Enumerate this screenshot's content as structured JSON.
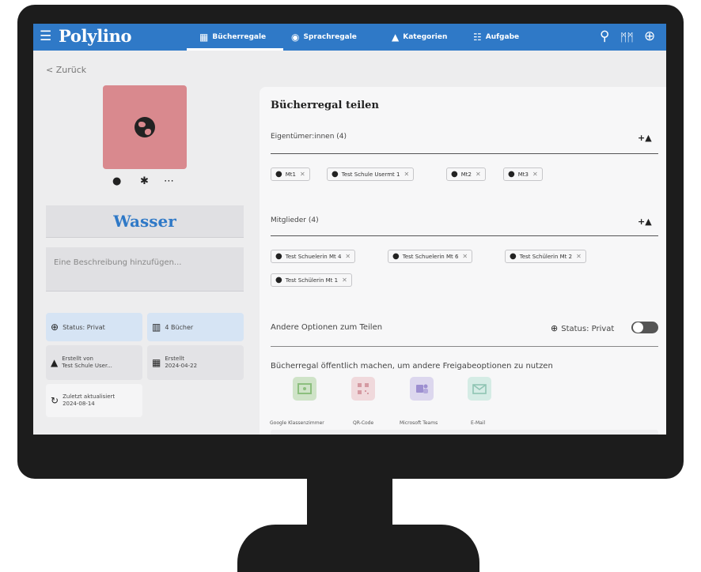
{
  "app": {
    "logo": "Polylino",
    "nav": [
      {
        "label": "Bücherregale",
        "icon": "grid-icon"
      },
      {
        "label": "Sprachregale",
        "icon": "language-icon"
      },
      {
        "label": "Kategorien",
        "icon": "categories-icon"
      },
      {
        "label": "Aufgabe",
        "icon": "tasks-icon"
      }
    ],
    "accent": "#2f79c7"
  },
  "back_label": "< Zurück",
  "shelf": {
    "title": "Wasser",
    "description_placeholder": "Eine Beschreibung hinzufügen...",
    "cover_color": "#d9898e",
    "info": {
      "status": "Status: Privat",
      "books": "4 Bücher",
      "created_by": "Erstellt von\nTest Schule User...",
      "created": "Erstellt\n2024-04-22",
      "updated": "Zuletzt aktualisiert\n2024-08-14"
    }
  },
  "share": {
    "title": "Bücherregal teilen",
    "owners_label": "Eigentümer:innen (4)",
    "owners": [
      "Mt1",
      "Test Schule Usermt 1",
      "Mt2",
      "Mt3"
    ],
    "members_label": "Mitglieder (4)",
    "members": [
      "Test Schuelerin Mt 4",
      "Test Schuelerin Mt 6",
      "Test Schülerin Mt 2",
      "Test Schülerin Mt 1"
    ],
    "other_options_label": "Andere Optionen zum Teilen",
    "status_label": "Status: Privat",
    "public_text": "Bücherregal öffentlich machen, um andere Freigabeoptionen zu nutzen",
    "services": [
      "Google Klassenzimmer",
      "QR-Code",
      "Microsoft Teams",
      "E-Mail"
    ]
  }
}
